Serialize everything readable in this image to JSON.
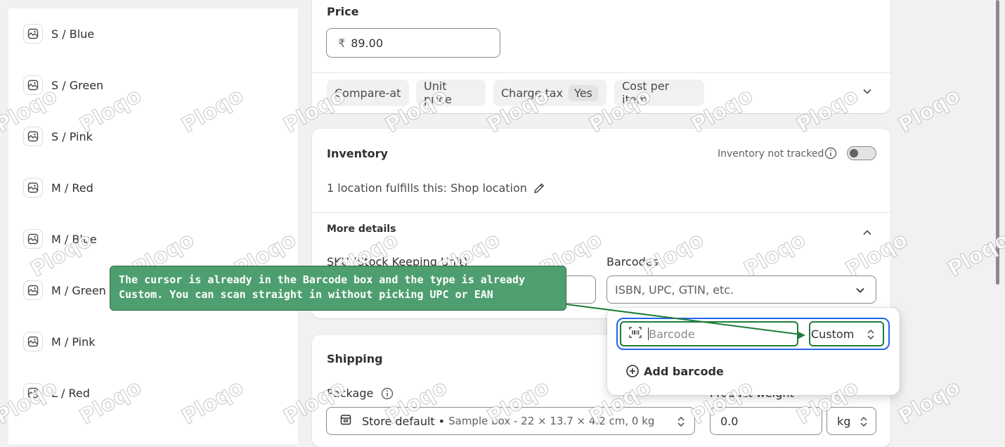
{
  "variants": [
    "S / Blue",
    "S / Green",
    "S / Pink",
    "M / Red",
    "M / Blue",
    "M / Green",
    "M / Pink",
    "L / Red"
  ],
  "pricing": {
    "price_label": "Price",
    "currency_symbol": "₹",
    "price_value": "89.00",
    "pills": {
      "compare_at": "Compare-at",
      "unit_price": "Unit price",
      "charge_tax": "Charge tax",
      "charge_tax_value": "Yes",
      "cost_per_item": "Cost per item"
    }
  },
  "inventory": {
    "title": "Inventory",
    "tracking_label": "Inventory not tracked",
    "location_text": "1 location fulfills this: Shop location",
    "more_details": "More details",
    "sku_label": "SKU (Stock Keeping Unit)",
    "barcodes_label": "Barcodes",
    "barcodes_placeholder": "ISBN, UPC, GTIN, etc."
  },
  "barcode_popover": {
    "input_placeholder": "Barcode",
    "type_value": "Custom",
    "add_label": "Add barcode"
  },
  "shipping": {
    "title": "Shipping",
    "package_label": "Package",
    "package_name": "Store default",
    "package_detail": "Sample box - 22 × 13.7 × 4.2 cm, 0 kg",
    "weight_label": "Product weight",
    "weight_value": "0.0",
    "weight_unit": "kg"
  },
  "annotation": {
    "text": "The cursor is already in the Barcode box and the type is already Custom. You can scan straight in without picking UPC or EAN",
    "color": "#4e9f6f"
  },
  "watermark": "Ploqo"
}
